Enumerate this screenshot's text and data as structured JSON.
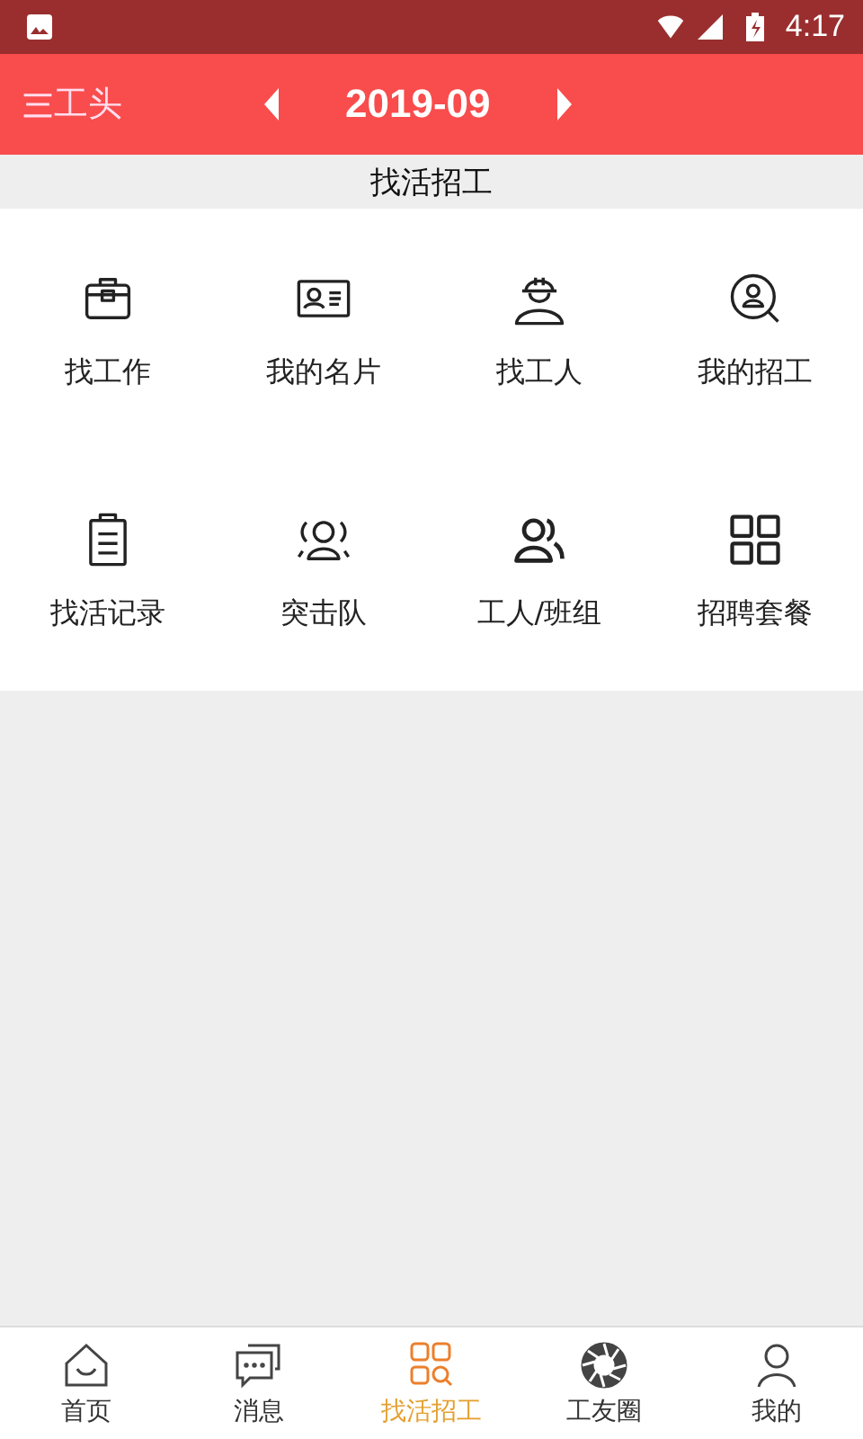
{
  "status_bar": {
    "time": "4:17"
  },
  "header": {
    "title": "工头",
    "period": "2019-09"
  },
  "section": {
    "title": "找活招工"
  },
  "grid": [
    {
      "label": "找工作"
    },
    {
      "label": "我的名片"
    },
    {
      "label": "找工人"
    },
    {
      "label": "我的招工"
    },
    {
      "label": "找活记录"
    },
    {
      "label": "突击队"
    },
    {
      "label": "工人/班组"
    },
    {
      "label": "招聘套餐"
    }
  ],
  "tabs": [
    {
      "label": "首页",
      "selected": false
    },
    {
      "label": "消息",
      "selected": false
    },
    {
      "label": "找活招工",
      "selected": true
    },
    {
      "label": "工友圈",
      "selected": false
    },
    {
      "label": "我的",
      "selected": false
    }
  ]
}
